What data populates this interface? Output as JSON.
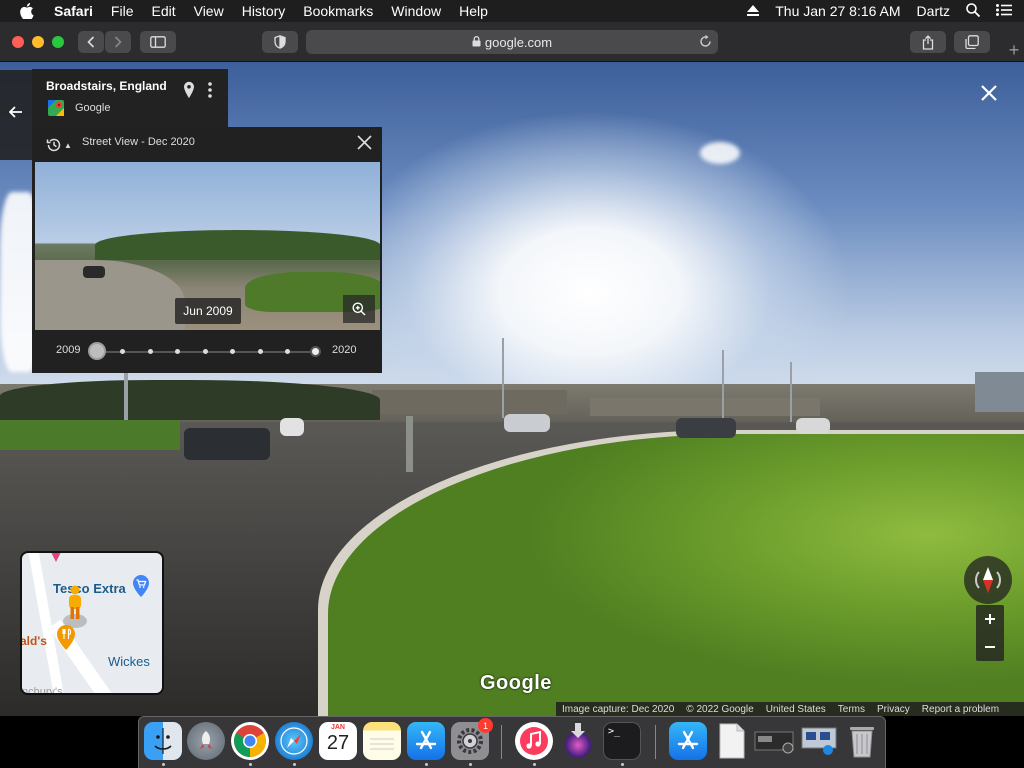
{
  "menubar": {
    "items": [
      "Safari",
      "File",
      "Edit",
      "View",
      "History",
      "Bookmarks",
      "Window",
      "Help"
    ],
    "datetime": "Thu Jan 27  8:16 AM",
    "user": "Dartz"
  },
  "browser": {
    "url": "google.com"
  },
  "place_card": {
    "title": "Broadstairs, England",
    "brand": "Google"
  },
  "time_machine": {
    "header": "Street View - Dec 2020",
    "selected_date": "Jun 2009",
    "start_year": "2009",
    "end_year": "2020",
    "timeline_points": 9
  },
  "minimap": {
    "labels": {
      "tesco": "Tesco Extra",
      "wickes": "Wickes",
      "alds": "ald's",
      "bottom": "nchurv's"
    }
  },
  "watermark": "Google",
  "footer": {
    "capture": "Image capture: Dec 2020",
    "copyright": "© 2022 Google",
    "region": "United States",
    "terms": "Terms",
    "privacy": "Privacy",
    "report": "Report a problem"
  },
  "dock": {
    "calendar_month": "JAN",
    "calendar_day": "27",
    "settings_badge": "1"
  },
  "colors": {
    "menubar": "#1e1e1e",
    "panel": "#212121",
    "grass": "#6c9d2c"
  }
}
